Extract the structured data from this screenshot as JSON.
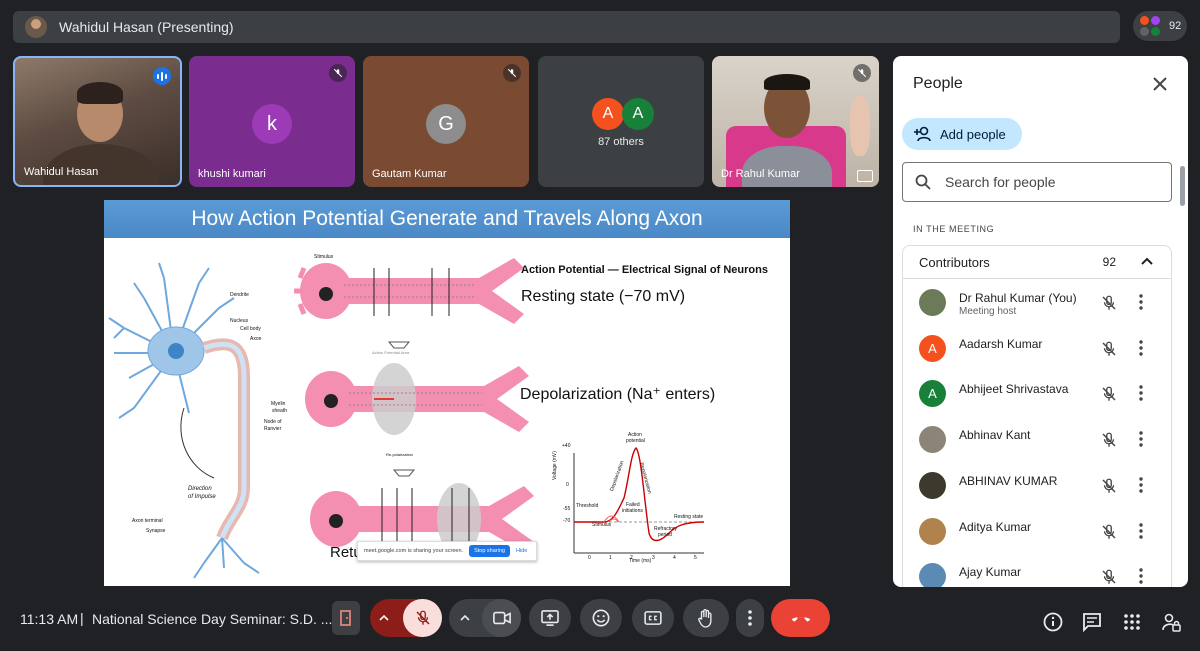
{
  "top_bar": {
    "presenter_title": "Wahidul Hasan (Presenting)",
    "participant_count": "92"
  },
  "tiles": {
    "wahidul": {
      "name": "Wahidul Hasan"
    },
    "khushi": {
      "name": "khushi kumari",
      "initial": "k"
    },
    "gautam": {
      "name": "Gautam Kumar",
      "initial": "G"
    },
    "others": {
      "label": "87 others",
      "initial_a": "A",
      "initial_b": "A"
    },
    "rahul": {
      "name": "Dr Rahul Kumar"
    }
  },
  "slide": {
    "title": "How Action Potential Generate and Travels Along Axon",
    "heading": "Action Potential — Electrical Signal of Neurons",
    "resting": "Resting state (−70 mV)",
    "depolarization": "Depolarization (Na⁺ enters)",
    "repolarization_partial": "Retu",
    "labels": {
      "dendrite": "Dendrite",
      "nucleus": "Nucleus",
      "cell_body": "Cell body",
      "axon": "Axon",
      "myelin": "Myelin",
      "sheath": "sheath",
      "node_of": "Node of",
      "ranvier": "Ranvier",
      "direction": "Direction",
      "of_impulse": "of Impulse",
      "axon_terminal": "Axon terminal",
      "synapse": "Synapse",
      "stimulus": "Stimulus",
      "action_potential_area": "Action Potential Area",
      "repolarization": "Re-polarization"
    },
    "graph": {
      "y_label": "Voltage (mV)",
      "x_label": "Time (ms)",
      "y_ticks": [
        "+40",
        "0",
        "-55",
        "-70"
      ],
      "x_ticks": [
        "0",
        "1",
        "2",
        "3",
        "4",
        "5"
      ],
      "action_potential": "Action",
      "potential": "potential",
      "depolarization": "Depolarization",
      "repolarization": "Repolarization",
      "threshold": "Threshold",
      "failed": "Failed",
      "initiations": "initiations",
      "stimulus": "Stimulus",
      "resting_state": "Resting state",
      "refractory": "Refractory",
      "period": "period"
    },
    "share_banner": {
      "text": "meet.google.com is sharing your screen.",
      "stop": "Stop sharing",
      "hide": "Hide"
    }
  },
  "panel": {
    "title": "People",
    "add_people": "Add people",
    "search_placeholder": "Search for people",
    "section": "IN THE MEETING",
    "group": {
      "label": "Contributors",
      "count": "92"
    },
    "people": [
      {
        "name": "Dr Rahul Kumar (You)",
        "sub": "Meeting host",
        "initial": "",
        "color": "#6b7b5a"
      },
      {
        "name": "Aadarsh Kumar",
        "sub": "",
        "initial": "A",
        "color": "#f4511e"
      },
      {
        "name": "Abhijeet Shrivastava",
        "sub": "",
        "initial": "A",
        "color": "#188038"
      },
      {
        "name": "Abhinav Kant",
        "sub": "",
        "initial": "",
        "color": "#8d8478"
      },
      {
        "name": "ABHINAV KUMAR",
        "sub": "",
        "initial": "",
        "color": "#3b3a2c"
      },
      {
        "name": "Aditya Kumar",
        "sub": "",
        "initial": "",
        "color": "#b0824c"
      },
      {
        "name": "Ajay Kumar",
        "sub": "",
        "initial": "",
        "color": "#5b8ab5"
      }
    ]
  },
  "bottom": {
    "time": "11:13 AM",
    "separator": "|",
    "meeting_title": "National Science Day Seminar: S.D. ..."
  },
  "colors": {
    "end_call": "#ea4335",
    "muted_red": "#f9dedc",
    "accent": "#1a73e8"
  }
}
